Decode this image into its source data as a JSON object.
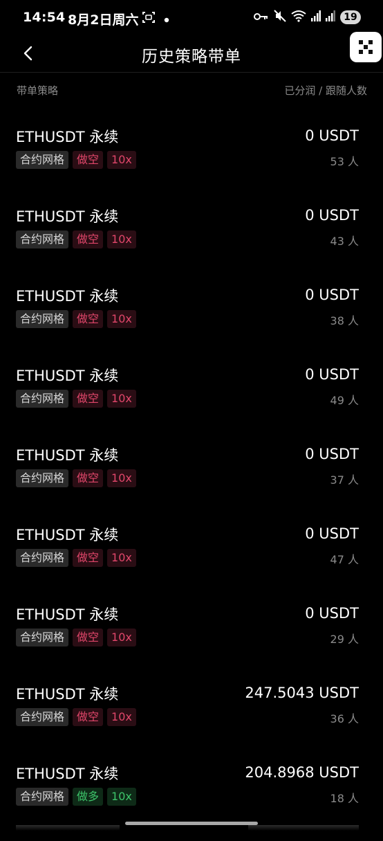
{
  "status_bar": {
    "time": "14:54",
    "date": "8月2日周六",
    "battery": "19"
  },
  "header": {
    "title": "历史策略带单"
  },
  "columns": {
    "left": "带单策略",
    "right": "已分润 / 跟随人数"
  },
  "colors": {
    "background": "#000000",
    "short_tag": "#e0466a",
    "long_tag": "#3dc46a",
    "muted_text": "#8a8a8a"
  },
  "rows": [
    {
      "pair": "ETHUSDT 永续",
      "type": "合约网格",
      "direction": "做空",
      "leverage": "10x",
      "amount": "0 USDT",
      "followers": "53 人"
    },
    {
      "pair": "ETHUSDT 永续",
      "type": "合约网格",
      "direction": "做空",
      "leverage": "10x",
      "amount": "0 USDT",
      "followers": "43 人"
    },
    {
      "pair": "ETHUSDT 永续",
      "type": "合约网格",
      "direction": "做空",
      "leverage": "10x",
      "amount": "0 USDT",
      "followers": "38 人"
    },
    {
      "pair": "ETHUSDT 永续",
      "type": "合约网格",
      "direction": "做空",
      "leverage": "10x",
      "amount": "0 USDT",
      "followers": "49 人"
    },
    {
      "pair": "ETHUSDT 永续",
      "type": "合约网格",
      "direction": "做空",
      "leverage": "10x",
      "amount": "0 USDT",
      "followers": "37 人"
    },
    {
      "pair": "ETHUSDT 永续",
      "type": "合约网格",
      "direction": "做空",
      "leverage": "10x",
      "amount": "0 USDT",
      "followers": "47 人"
    },
    {
      "pair": "ETHUSDT 永续",
      "type": "合约网格",
      "direction": "做空",
      "leverage": "10x",
      "amount": "0 USDT",
      "followers": "29 人"
    },
    {
      "pair": "ETHUSDT 永续",
      "type": "合约网格",
      "direction": "做空",
      "leverage": "10x",
      "amount": "247.5043 USDT",
      "followers": "36 人"
    },
    {
      "pair": "ETHUSDT 永续",
      "type": "合约网格",
      "direction": "做多",
      "leverage": "10x",
      "amount": "204.8968 USDT",
      "followers": "18 人"
    }
  ]
}
